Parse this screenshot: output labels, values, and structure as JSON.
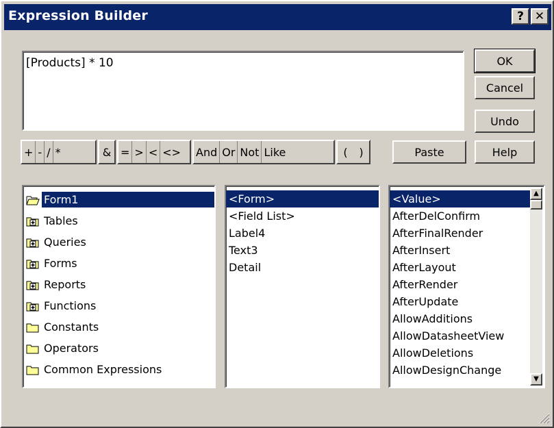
{
  "window": {
    "title": "Expression Builder"
  },
  "titlebar": {
    "help_label": "?",
    "close_label": "✕"
  },
  "expression": {
    "value": "[Products] * 10"
  },
  "buttons": {
    "ok": "OK",
    "cancel": "Cancel",
    "undo": "Undo",
    "paste": "Paste",
    "help": "Help"
  },
  "operators": {
    "arith": [
      "+",
      "-",
      "/",
      "*"
    ],
    "concat": "&",
    "compare": [
      "=",
      ">",
      "<",
      "<>"
    ],
    "logic": [
      "And",
      "Or",
      "Not",
      "Like"
    ],
    "parens": [
      "(",
      ")"
    ]
  },
  "list1": {
    "items": [
      {
        "label": "Form1",
        "icon": "open-folder-icon"
      },
      {
        "label": "Tables",
        "icon": "plus-folder-icon"
      },
      {
        "label": "Queries",
        "icon": "plus-folder-icon"
      },
      {
        "label": "Forms",
        "icon": "plus-folder-icon"
      },
      {
        "label": "Reports",
        "icon": "plus-folder-icon"
      },
      {
        "label": "Functions",
        "icon": "plus-folder-icon"
      },
      {
        "label": "Constants",
        "icon": "folder-icon"
      },
      {
        "label": "Operators",
        "icon": "folder-icon"
      },
      {
        "label": "Common Expressions",
        "icon": "folder-icon"
      }
    ],
    "selected": "Form1"
  },
  "list2": {
    "items": [
      "<Form>",
      "<Field List>",
      "Label4",
      "Text3",
      "Detail"
    ],
    "selected": "<Form>"
  },
  "list3": {
    "items": [
      "<Value>",
      "AfterDelConfirm",
      "AfterFinalRender",
      "AfterInsert",
      "AfterLayout",
      "AfterRender",
      "AfterUpdate",
      "AllowAdditions",
      "AllowDatasheetView",
      "AllowDeletions",
      "AllowDesignChange"
    ],
    "selected": "<Value>"
  },
  "colors": {
    "titlebar": "#0a246a",
    "face": "#d4d0c8",
    "selection": "#0a246a"
  }
}
